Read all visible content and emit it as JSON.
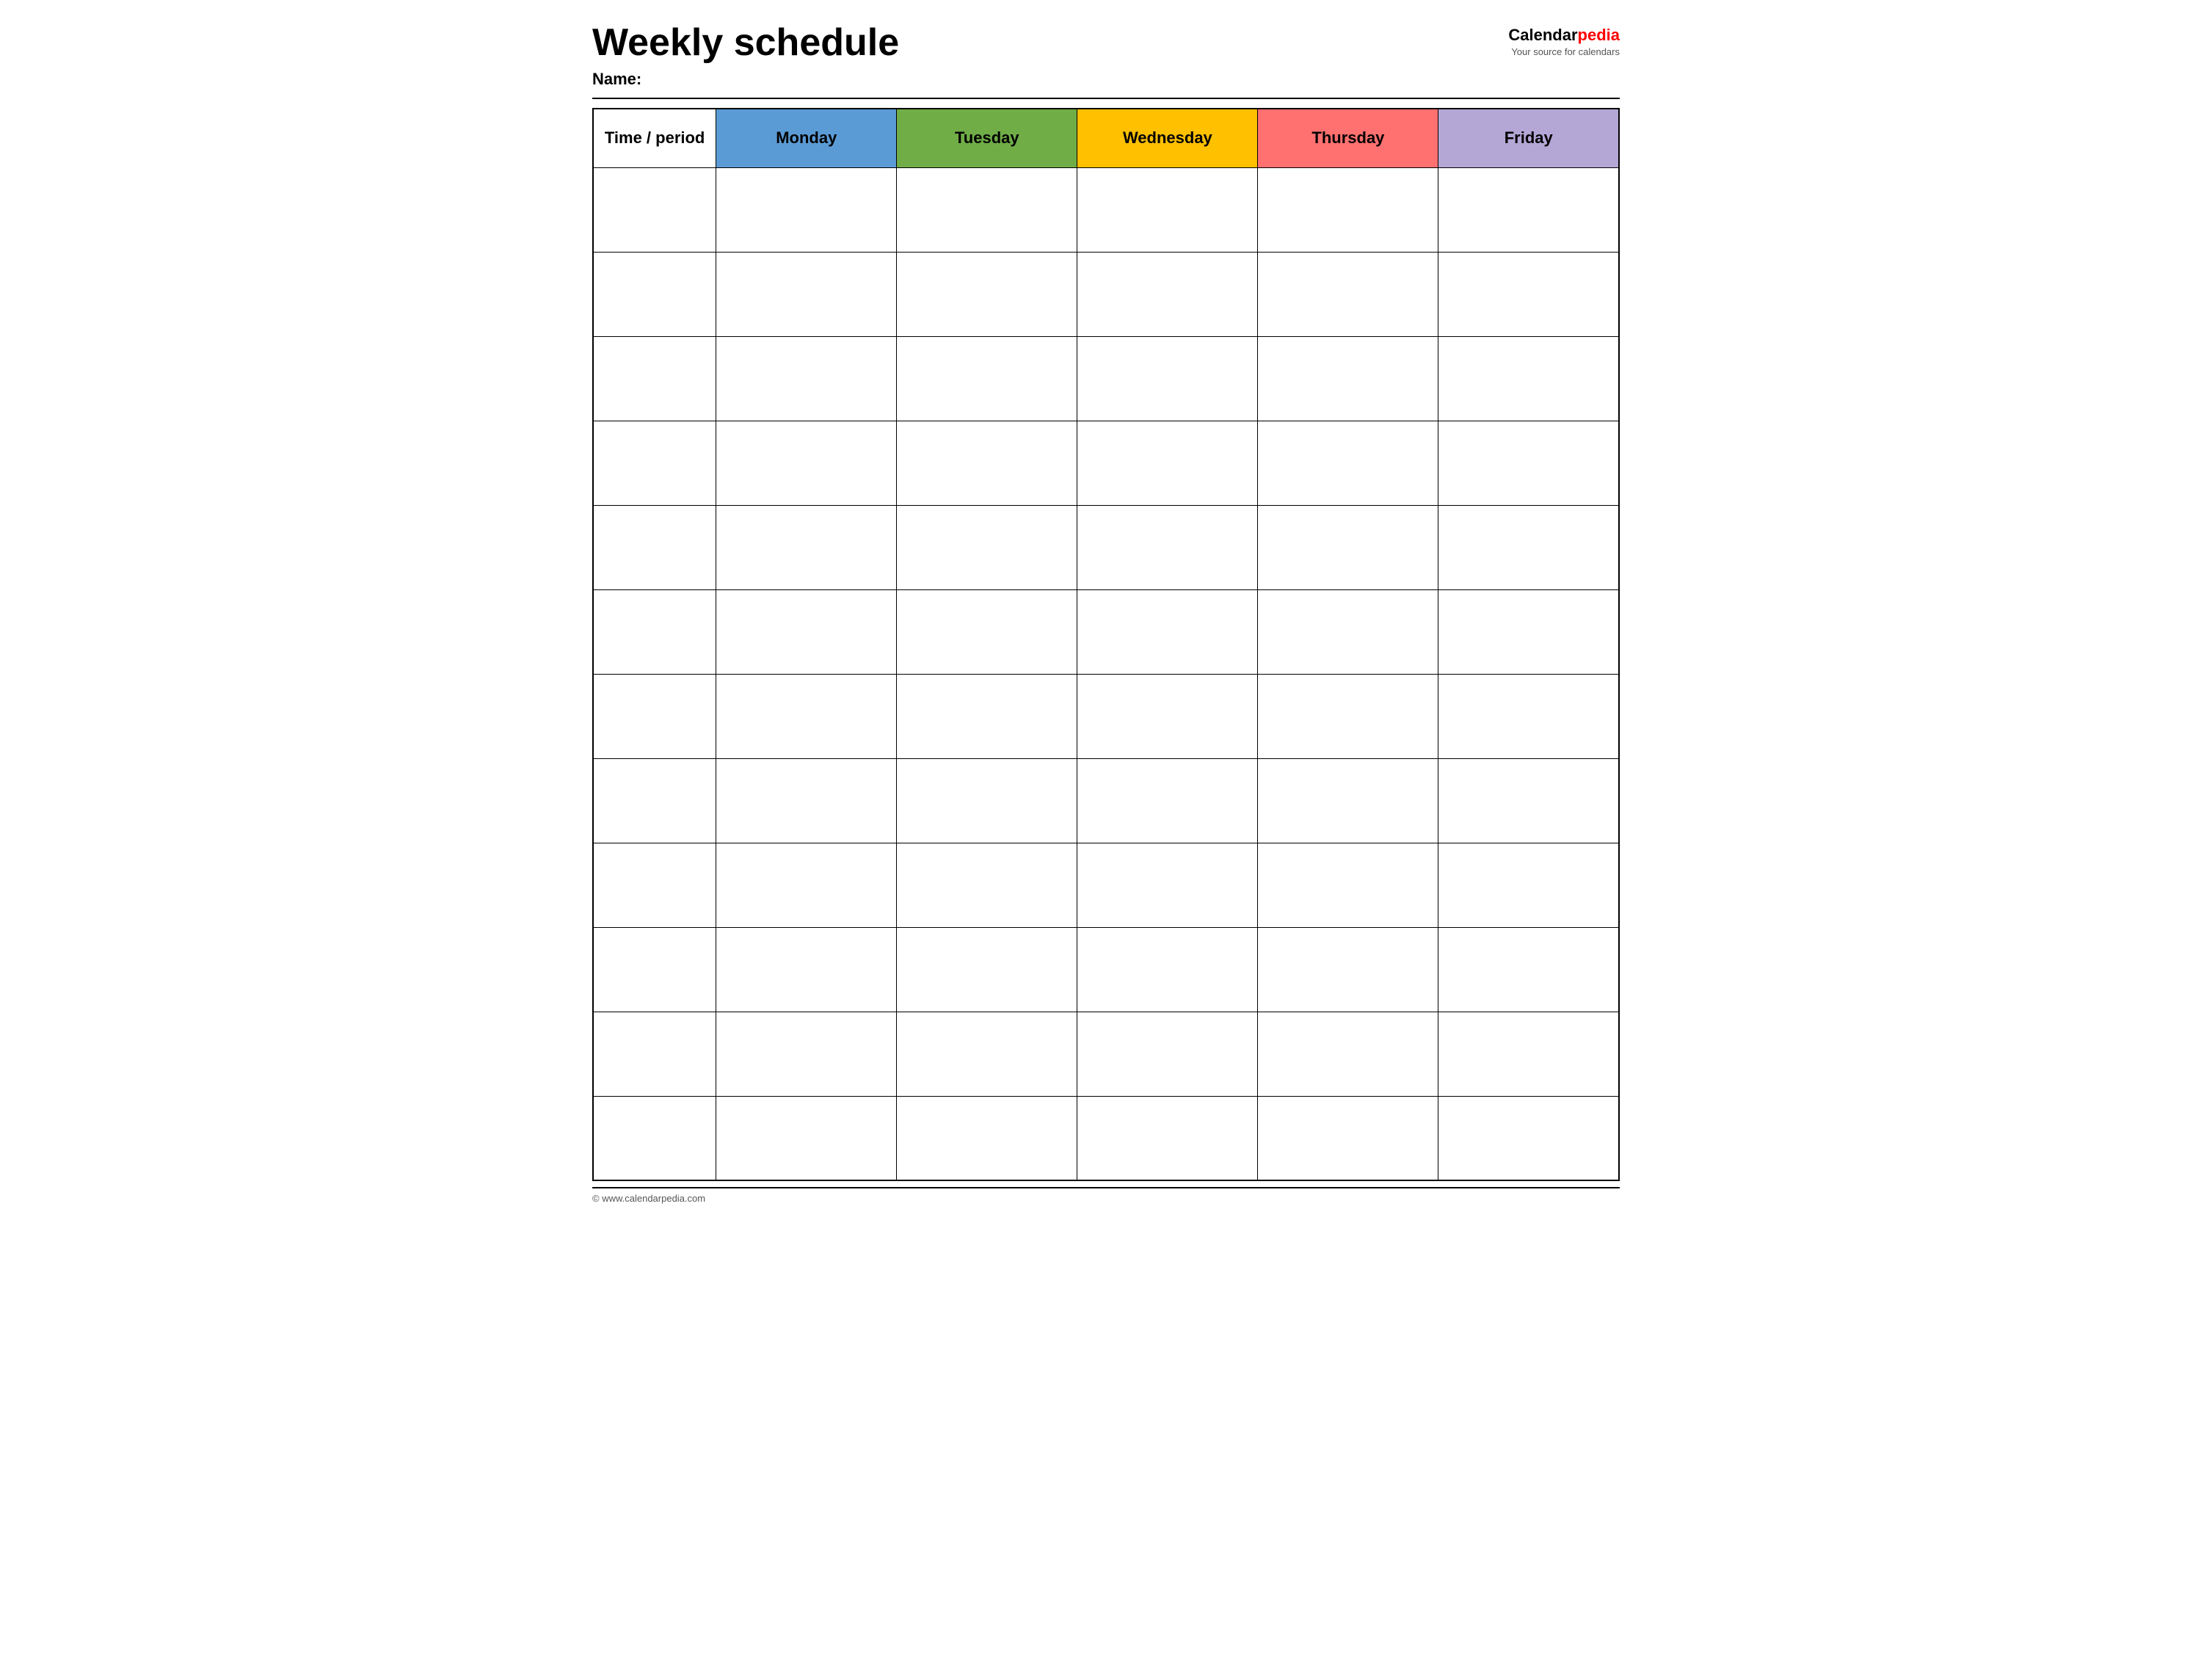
{
  "header": {
    "main_title": "Weekly schedule",
    "name_label": "Name:",
    "logo_calendar": "Calendar",
    "logo_pedia": "pedia",
    "logo_subtitle": "Your source for calendars"
  },
  "table": {
    "columns": [
      {
        "id": "time",
        "label": "Time / period",
        "color": "#ffffff"
      },
      {
        "id": "monday",
        "label": "Monday",
        "color": "#5b9bd5"
      },
      {
        "id": "tuesday",
        "label": "Tuesday",
        "color": "#70ad47"
      },
      {
        "id": "wednesday",
        "label": "Wednesday",
        "color": "#ffc000"
      },
      {
        "id": "thursday",
        "label": "Thursday",
        "color": "#ff7070"
      },
      {
        "id": "friday",
        "label": "Friday",
        "color": "#b4a7d6"
      }
    ],
    "row_count": 12
  },
  "footer": {
    "copyright": "© www.calendarpedia.com"
  }
}
